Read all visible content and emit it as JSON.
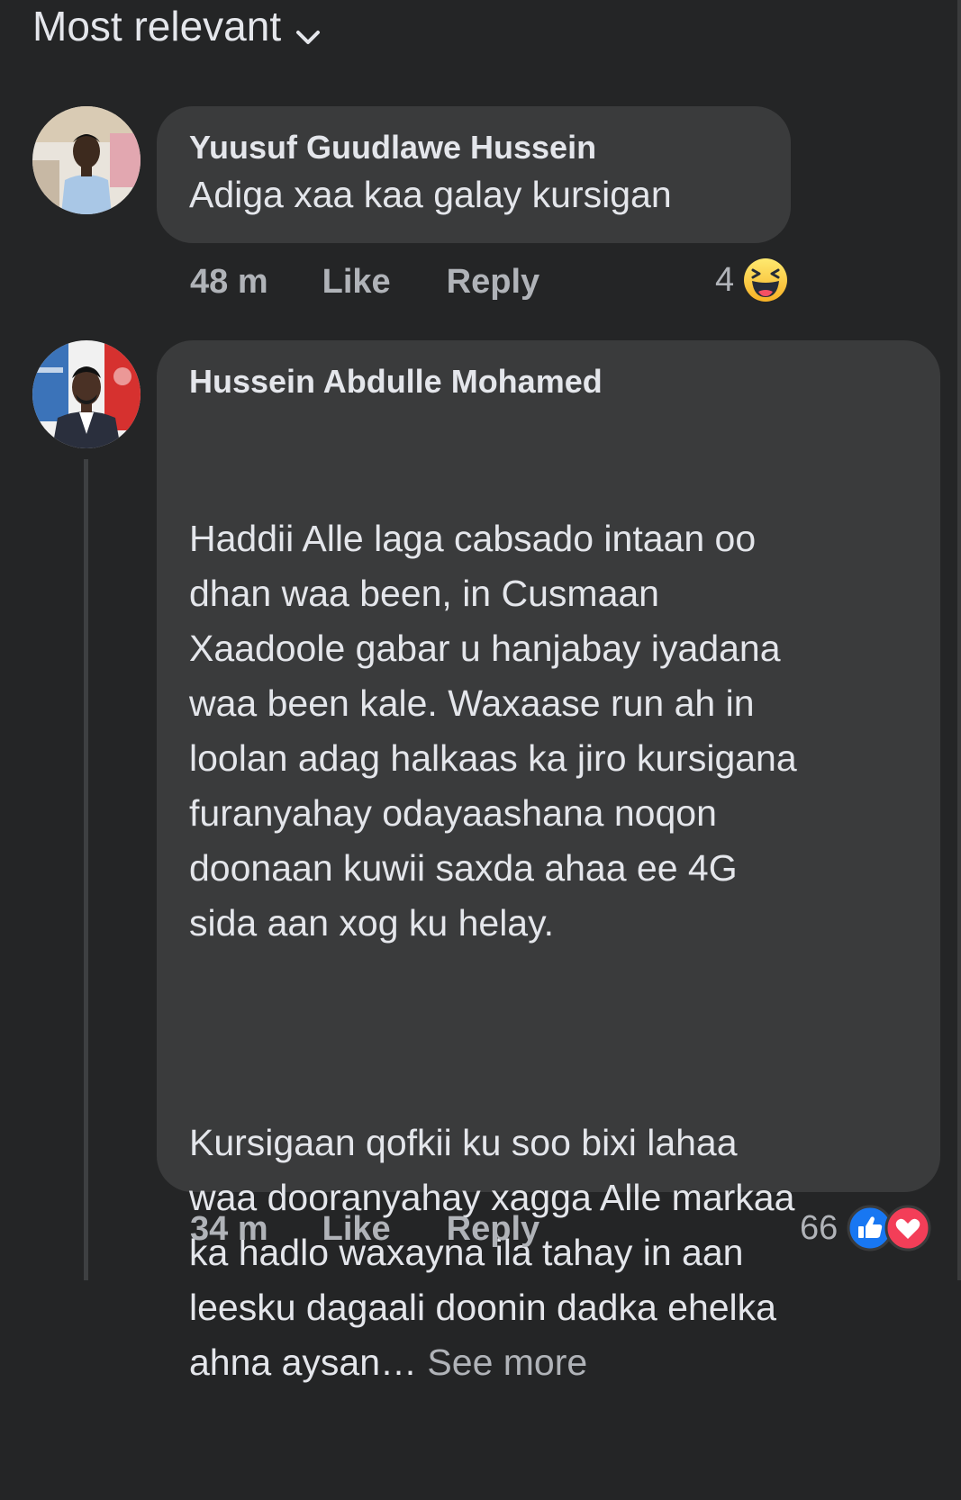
{
  "sort": {
    "label": "Most relevant",
    "icon": "chevron-down-icon"
  },
  "comments": [
    {
      "author": "Yuusuf Guudlawe Hussein",
      "text": "Adiga xaa kaa galay kursigan",
      "time": "48 m",
      "like_label": "Like",
      "reply_label": "Reply",
      "reaction_count": "4",
      "reactions": [
        "haha-icon"
      ]
    },
    {
      "author": "Hussein Abdulle Mohamed",
      "paragraph1": "Haddii Alle laga cabsado intaan oo\ndhan waa been, in Cusmaan\nXaadoole gabar u hanjabay iyadana\nwaa been kale. Waxaase run ah in\nloolan adag halkaas ka jiro kursigana\nfuranyahay odayaashana noqon\ndoonaan kuwii saxda ahaa ee 4G\nsida aan xog ku helay.",
      "paragraph2": "Kursigaan qofkii ku soo bixi lahaa\nwaa dooranyahay xagga Alle markaa\nka hadlo waxayna ila tahay in aan\nleesku dagaali doonin dadka ehelka\nahna aysan…",
      "see_more": "See more",
      "time": "34 m",
      "like_label": "Like",
      "reply_label": "Reply",
      "reaction_count": "66",
      "reactions": [
        "like-icon",
        "love-icon"
      ]
    }
  ],
  "colors": {
    "background": "#242526",
    "bubble": "#3a3b3c",
    "primary_text": "#e4e6eb",
    "secondary_text": "#b0b3b8",
    "like_blue": "#1877f2",
    "love_red": "#f33e58",
    "haha_yellow": "#f7b125"
  }
}
